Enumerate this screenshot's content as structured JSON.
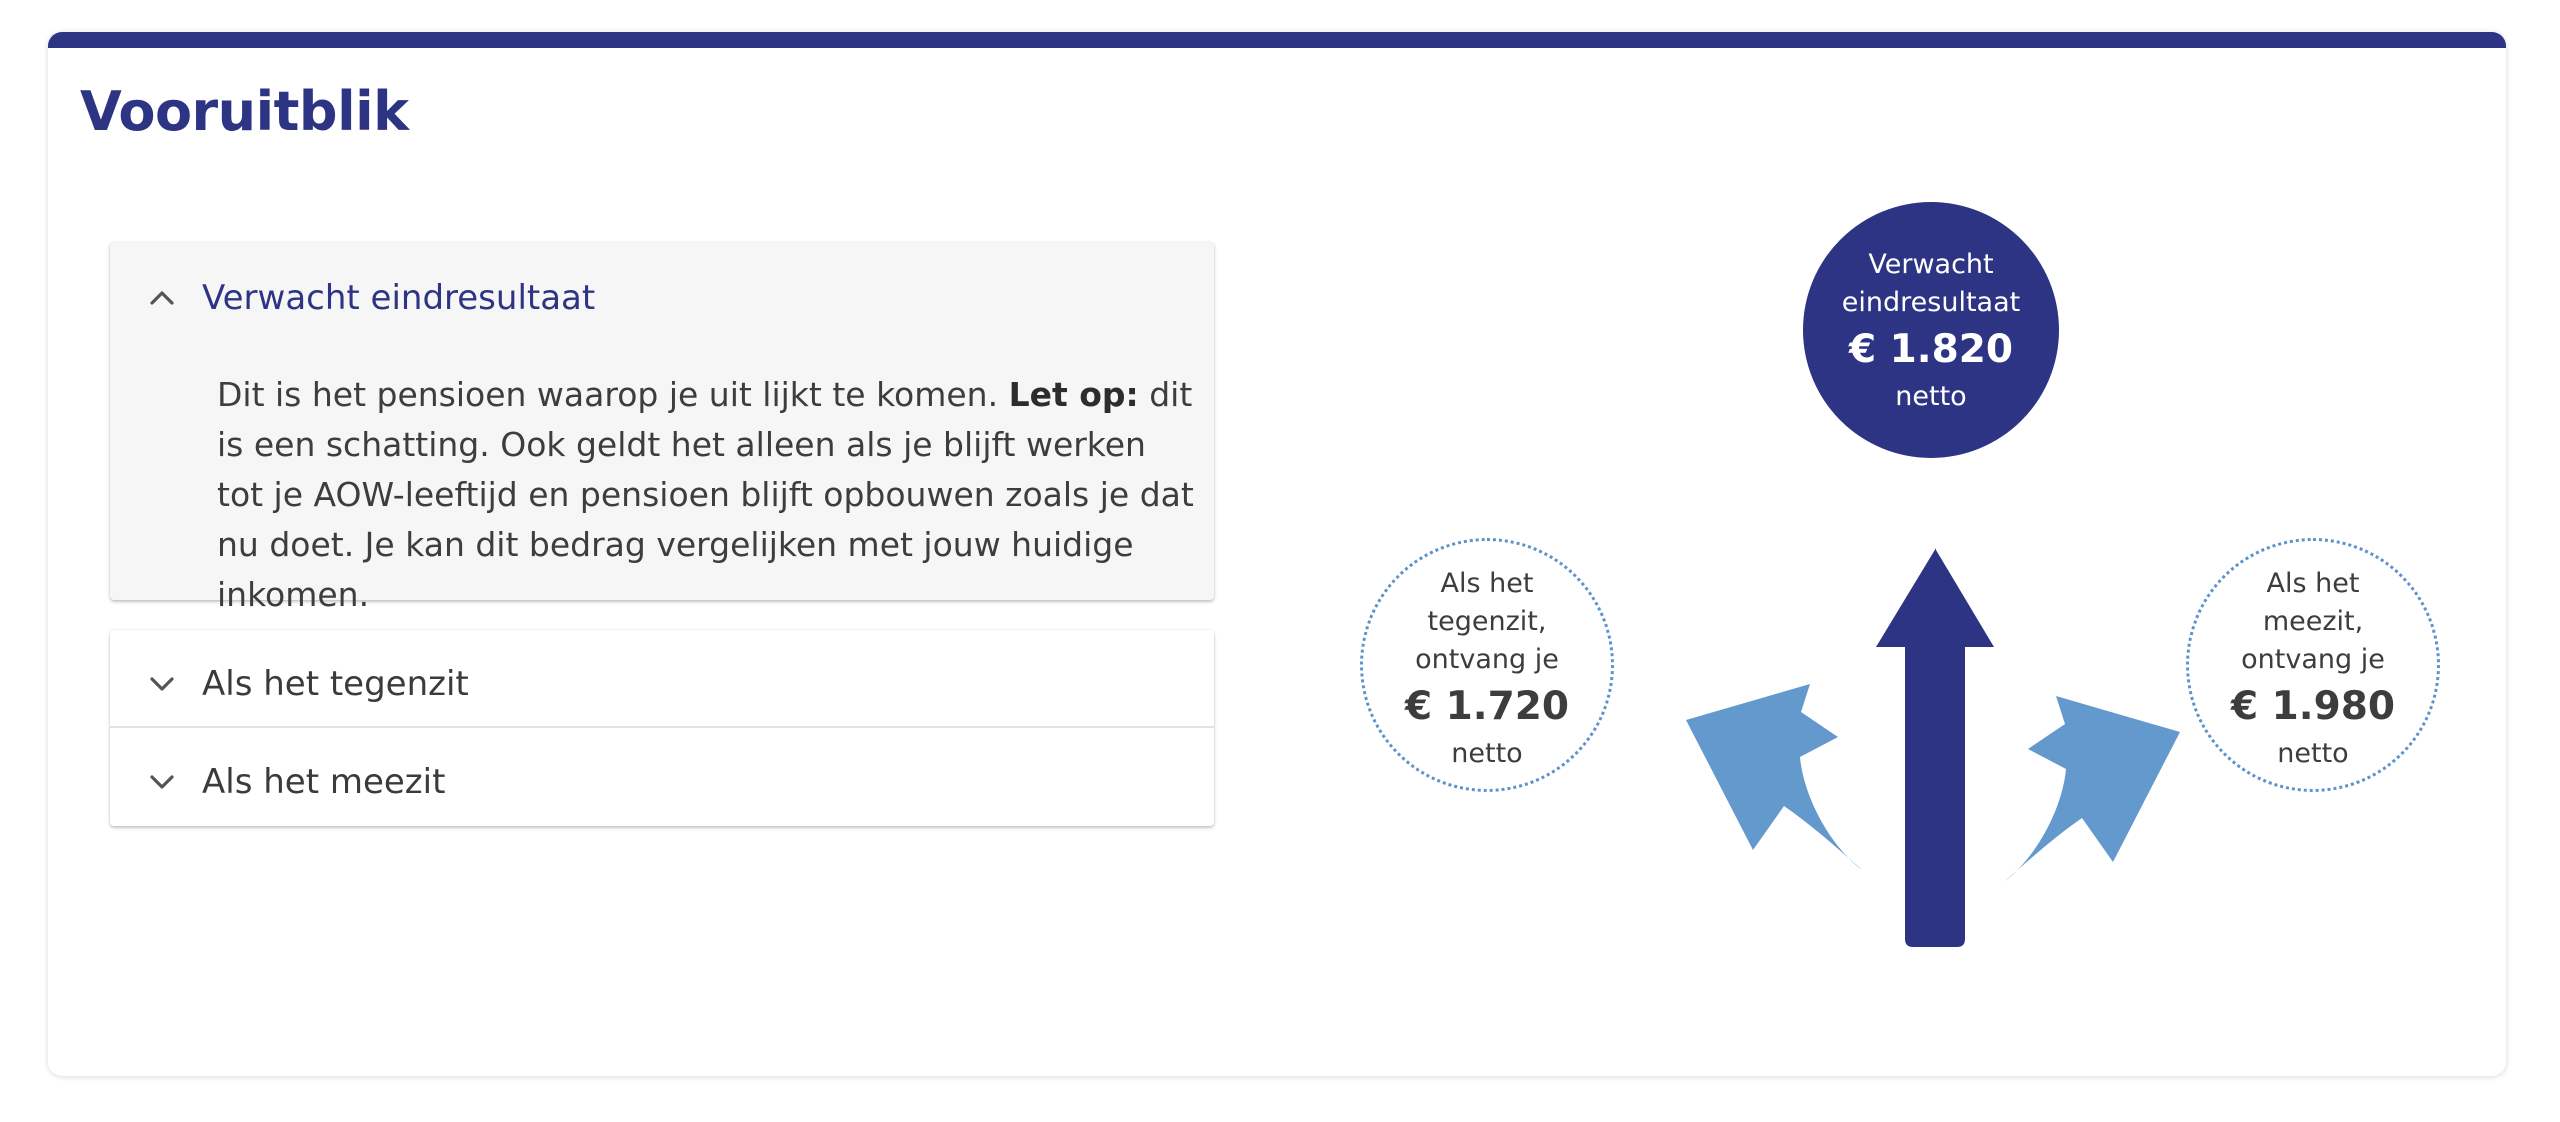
{
  "title": "Vooruitblik",
  "accordion": {
    "open": {
      "label": "Verwacht eindresultaat",
      "icon": "chevron-up-icon",
      "body_before": "Dit is het pensioen waarop je uit lijkt te komen. ",
      "body_bold": "Let op:",
      "body_after": " dit is een schatting. Ook geldt het alleen als je blijft werken tot je AOW-leeftijd en pensioen blijft opbouwen zoals je dat nu doet. Je kan dit bedrag vergelijken met jouw huidige inkomen."
    },
    "items": [
      {
        "label": "Als het tegenzit",
        "icon": "chevron-down-icon"
      },
      {
        "label": "Als het meezit",
        "icon": "chevron-down-icon"
      }
    ]
  },
  "graphic": {
    "expected": {
      "line1": "Verwacht",
      "line2": "eindresultaat",
      "amount": "€ 1.820",
      "unit": "netto"
    },
    "bad": {
      "line1": "Als het",
      "line2": "tegenzit,",
      "line3": "ontvang je",
      "amount": "€ 1.720",
      "unit": "netto"
    },
    "good": {
      "line1": "Als het",
      "line2": "meezit,",
      "line3": "ontvang je",
      "amount": "€ 1.980",
      "unit": "netto"
    }
  },
  "colors": {
    "primary": "#2d3484",
    "secondary": "#6399cd",
    "text": "#3d3d3d"
  }
}
